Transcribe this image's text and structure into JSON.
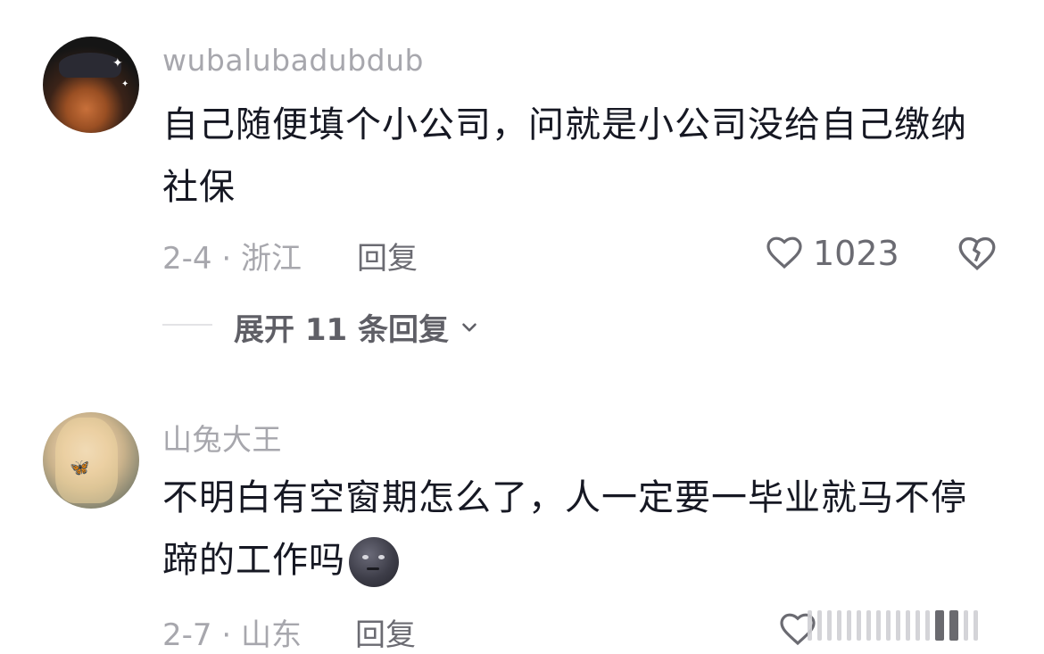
{
  "comments": [
    {
      "username": "wubalubadubdub",
      "text": "自己随便填个小公司，问就是小公司没给自己缴纳社保",
      "date": "2-4",
      "location": "浙江",
      "reply_label": "回复",
      "like_count": "1023",
      "expand_label": "展开 11 条回复"
    },
    {
      "username": "山兔大王",
      "text": "不明白有空窗期怎么了，人一定要一毕业就马不停蹄的工作吗",
      "date": "2-7",
      "location": "山东",
      "reply_label": "回复"
    }
  ],
  "icons": {
    "like": "heart-outline-icon",
    "dislike": "broken-heart-icon",
    "expand": "chevron-down-icon",
    "emoji": "new-moon-face-emoji"
  },
  "colors": {
    "text_primary": "#161823",
    "text_secondary": "#a7a7ad",
    "icon": "#6b6b72"
  }
}
